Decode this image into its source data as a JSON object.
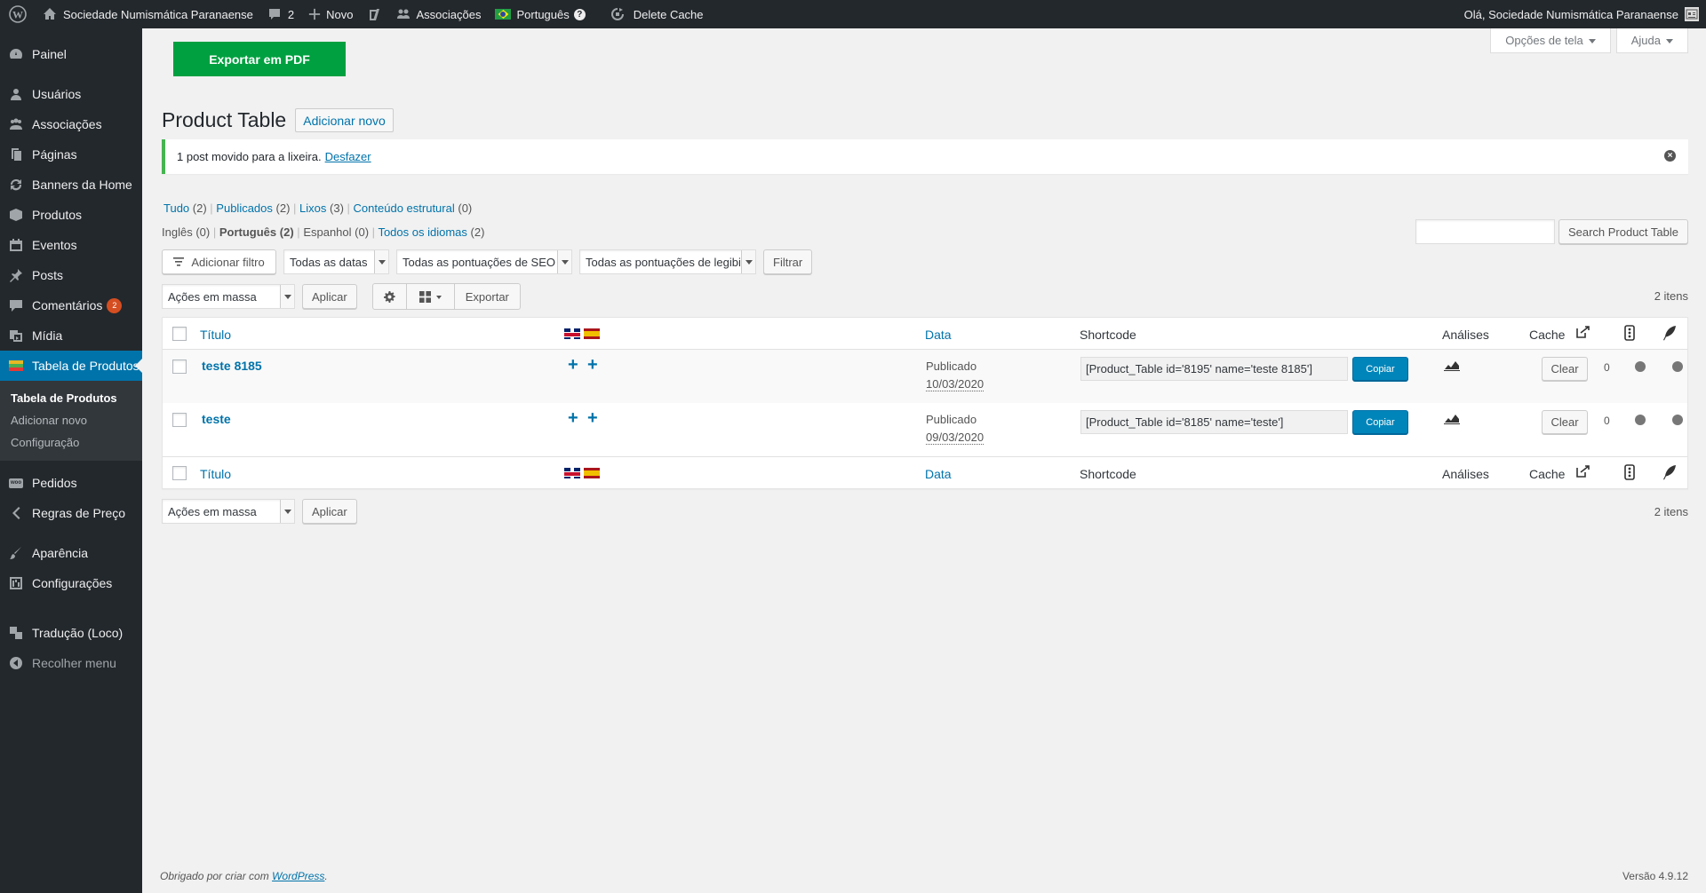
{
  "adminbar": {
    "site_name": "Sociedade Numismática Paranaense",
    "comments_count": "2",
    "new_label": "Novo",
    "associations_label": "Associações",
    "language_label": "Português",
    "delete_cache_label": "Delete Cache",
    "greeting": "Olá, Sociedade Numismática Paranaense"
  },
  "sidebar": {
    "items": [
      {
        "label": "Painel",
        "icon": "dashboard-icon"
      },
      {
        "label": "Usuários",
        "icon": "users-icon"
      },
      {
        "label": "Associações",
        "icon": "groups-icon"
      },
      {
        "label": "Páginas",
        "icon": "pages-icon"
      },
      {
        "label": "Banners da Home",
        "icon": "update-icon"
      },
      {
        "label": "Produtos",
        "icon": "box-icon"
      },
      {
        "label": "Eventos",
        "icon": "calendar-icon"
      },
      {
        "label": "Posts",
        "icon": "pin-icon"
      },
      {
        "label": "Comentários",
        "icon": "comments-icon",
        "badge": "2"
      },
      {
        "label": "Mídia",
        "icon": "media-icon"
      },
      {
        "label": "Tabela de Produtos",
        "icon": "table-icon"
      }
    ],
    "submenu": [
      "Tabela de Produtos",
      "Adicionar novo",
      "Configuração"
    ],
    "items2": [
      {
        "label": "Pedidos",
        "icon": "woo-icon"
      },
      {
        "label": "Regras de Preço",
        "icon": "chevron-left-icon"
      },
      {
        "label": "Aparência",
        "icon": "brush-icon"
      },
      {
        "label": "Configurações",
        "icon": "settings-icon"
      },
      {
        "label": "Tradução (Loco)",
        "icon": "translation-icon"
      },
      {
        "label": "Recolher menu",
        "icon": "collapse-icon"
      }
    ]
  },
  "screen_options": {
    "options_label": "Opções de tela",
    "help_label": "Ajuda"
  },
  "export_pdf_label": "Exportar em PDF",
  "page": {
    "title": "Product Table",
    "add_new_label": "Adicionar novo"
  },
  "notice": {
    "text": "1 post movido para a lixeira.",
    "undo_label": "Desfazer"
  },
  "status_filters": [
    {
      "label": "Tudo",
      "count": "(2)"
    },
    {
      "label": "Publicados",
      "count": "(2)"
    },
    {
      "label": "Lixos",
      "count": "(3)"
    },
    {
      "label": "Conteúdo estrutural",
      "count": "(0)"
    }
  ],
  "language_filters": [
    {
      "label": "Inglês",
      "count": "(0)"
    },
    {
      "label": "Português",
      "count": "(2)"
    },
    {
      "label": "Espanhol",
      "count": "(0)"
    },
    {
      "label": "Todos os idiomas",
      "count": "(2)"
    }
  ],
  "search": {
    "button_label": "Search Product Table",
    "value": ""
  },
  "filters": {
    "add_filter_label": "Adicionar filtro",
    "dates": "Todas as datas",
    "seo": "Todas as pontuações de SEO",
    "readability": "Todas as pontuações de legibilidade",
    "filter_button": "Filtrar"
  },
  "bulk": {
    "actions": "Ações em massa",
    "apply": "Aplicar",
    "export": "Exportar"
  },
  "items_count": "2 itens",
  "table": {
    "columns": {
      "title": "Título",
      "date": "Data",
      "shortcode": "Shortcode",
      "analyses": "Análises",
      "cache": "Cache"
    },
    "rows": [
      {
        "title": "teste 8185",
        "status": "Publicado",
        "date": "10/03/2020",
        "shortcode": "[Product_Table id='8195' name='teste 8185']",
        "copy": "Copiar",
        "clear": "Clear",
        "count": "0"
      },
      {
        "title": "teste",
        "status": "Publicado",
        "date": "09/03/2020",
        "shortcode": "[Product_Table id='8185' name='teste']",
        "copy": "Copiar",
        "clear": "Clear",
        "count": "0"
      }
    ]
  },
  "footer": {
    "thanks": "Obrigado por criar com",
    "wp_link": "WordPress",
    "version": "Versão 4.9.12"
  },
  "colors": {
    "primary": "#0085ba",
    "export_green": "#00a040",
    "sidebar_bg": "#23282d",
    "current_menu": "#0073aa"
  }
}
